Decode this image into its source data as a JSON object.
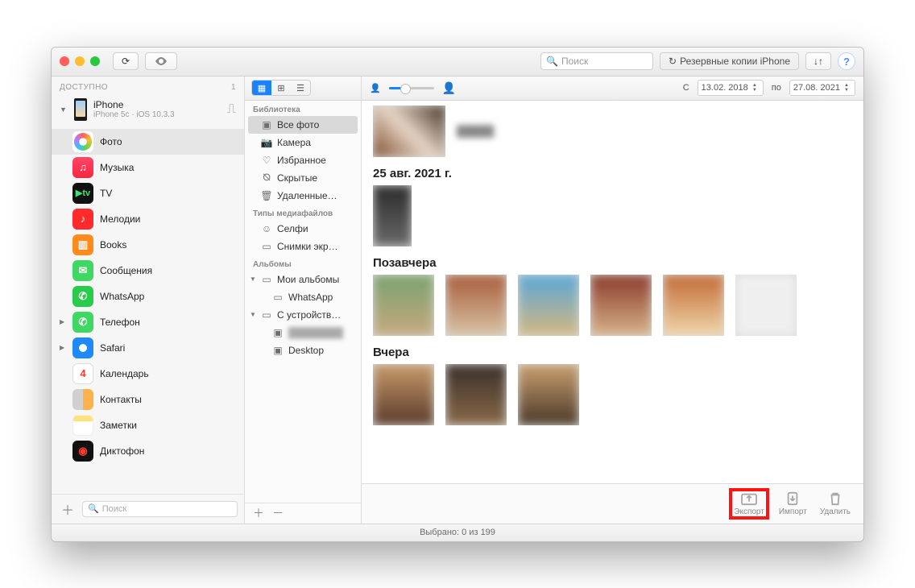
{
  "toolbar": {
    "search_placeholder": "Поиск",
    "backups_label": "Резервные копии iPhone"
  },
  "sidebar": {
    "section": "ДОСТУПНО",
    "count": "1",
    "device": {
      "name": "iPhone",
      "sub": "iPhone 5c · iOS 10.3.3"
    },
    "items": [
      {
        "label": "Фото"
      },
      {
        "label": "Музыка"
      },
      {
        "label": "TV"
      },
      {
        "label": "Мелодии"
      },
      {
        "label": "Books"
      },
      {
        "label": "Сообщения"
      },
      {
        "label": "WhatsApp"
      },
      {
        "label": "Телефон"
      },
      {
        "label": "Safari"
      },
      {
        "label": "Календарь"
      },
      {
        "label": "Контакты"
      },
      {
        "label": "Заметки"
      },
      {
        "label": "Диктофон"
      }
    ],
    "calendar_day": "4",
    "search_placeholder": "Поиск"
  },
  "library": {
    "h_library": "Библиотека",
    "all": "Все фото",
    "camera": "Камера",
    "fav": "Избранное",
    "hidden": "Скрытые",
    "deleted": "Удаленные…",
    "h_media": "Типы медиафайлов",
    "selfie": "Селфи",
    "screens": "Снимки экр…",
    "h_albums": "Альбомы",
    "my_albums": "Мои альбомы",
    "whatsapp": "WhatsApp",
    "from_device": "С устройств…",
    "desktop": "Desktop"
  },
  "filter": {
    "from_label": "С",
    "to_label": "по",
    "date_from": "13.02. 2018",
    "date_to": "27.08. 2021"
  },
  "groups": {
    "g1": "25 авг. 2021 г.",
    "g2": "Позавчера",
    "g3": "Вчера"
  },
  "actions": {
    "export": "Экспорт",
    "import": "Импорт",
    "delete": "Удалить"
  },
  "status": "Выбрано: 0 из 199"
}
